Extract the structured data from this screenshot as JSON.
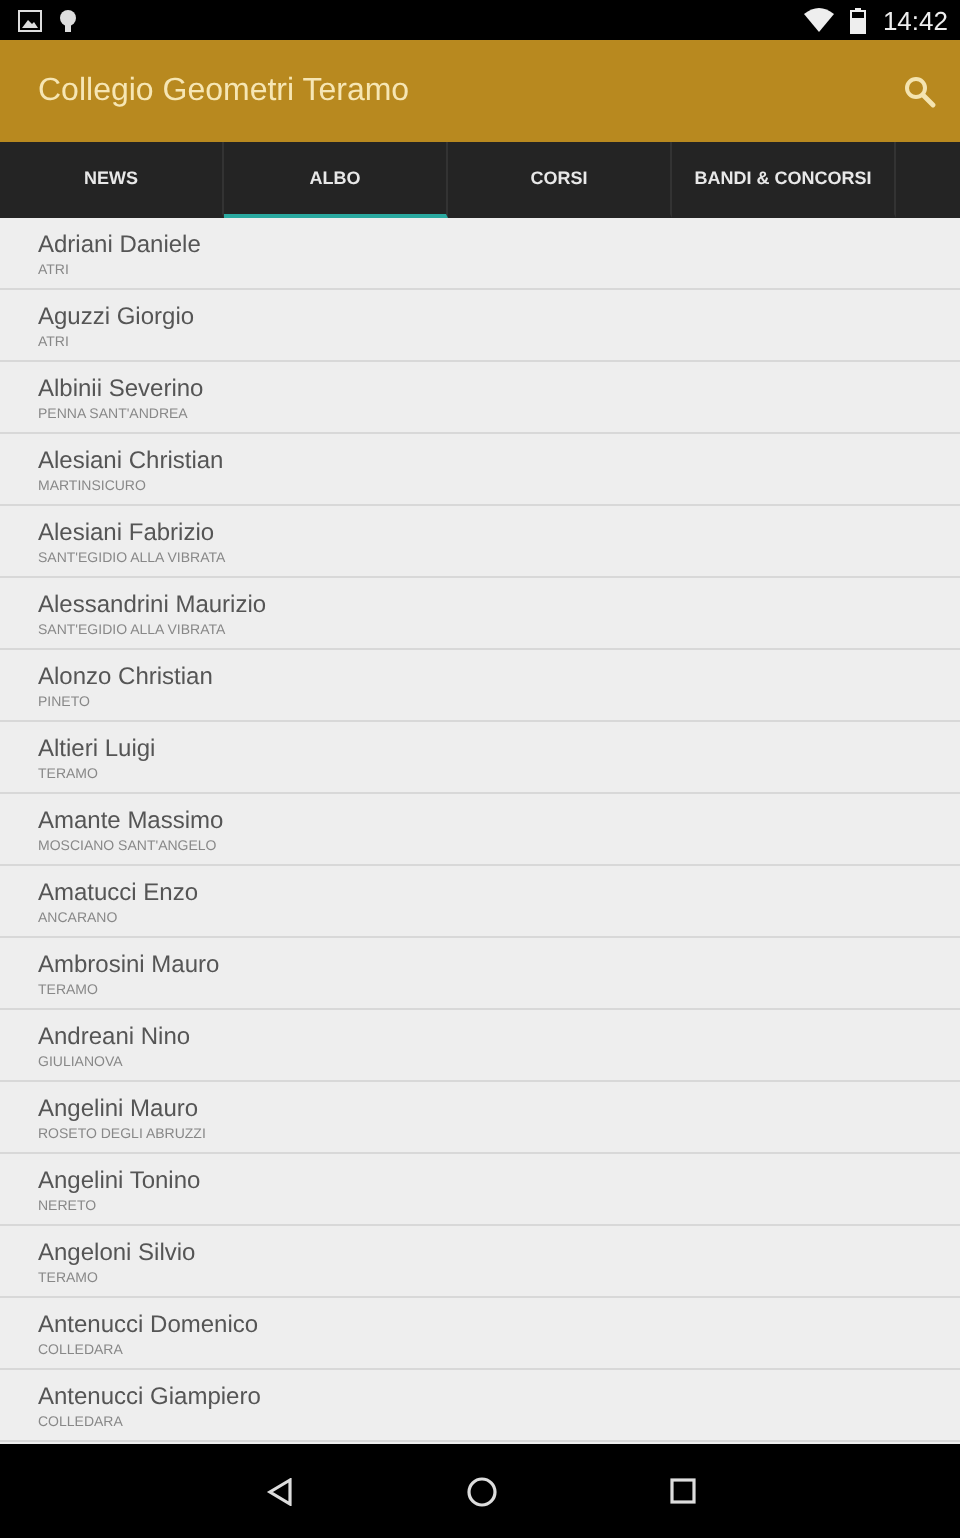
{
  "status_bar": {
    "time": "14:42"
  },
  "app_bar": {
    "title": "Collegio Geometri Teramo"
  },
  "tabs": [
    {
      "label": "NEWS",
      "selected": false
    },
    {
      "label": "ALBO",
      "selected": true
    },
    {
      "label": "CORSI",
      "selected": false
    },
    {
      "label": "BANDI & CONCORSI",
      "selected": false
    }
  ],
  "members": [
    {
      "name": "Adriani Daniele",
      "town": "ATRI"
    },
    {
      "name": "Aguzzi Giorgio",
      "town": "ATRI"
    },
    {
      "name": "Albinii Severino",
      "town": "PENNA SANT'ANDREA"
    },
    {
      "name": "Alesiani Christian",
      "town": "MARTINSICURO"
    },
    {
      "name": "Alesiani Fabrizio",
      "town": "SANT'EGIDIO ALLA VIBRATA"
    },
    {
      "name": "Alessandrini Maurizio",
      "town": "SANT'EGIDIO ALLA VIBRATA"
    },
    {
      "name": "Alonzo Christian",
      "town": "PINETO"
    },
    {
      "name": "Altieri Luigi",
      "town": "TERAMO"
    },
    {
      "name": "Amante Massimo",
      "town": "MOSCIANO SANT'ANGELO"
    },
    {
      "name": "Amatucci Enzo",
      "town": "ANCARANO"
    },
    {
      "name": "Ambrosini Mauro",
      "town": "TERAMO"
    },
    {
      "name": "Andreani Nino",
      "town": "GIULIANOVA"
    },
    {
      "name": "Angelini Mauro",
      "town": "ROSETO DEGLI ABRUZZI"
    },
    {
      "name": "Angelini Tonino",
      "town": "NERETO"
    },
    {
      "name": "Angeloni Silvio",
      "town": "TERAMO"
    },
    {
      "name": "Antenucci Domenico",
      "town": "COLLEDARA"
    },
    {
      "name": "Antenucci Giampiero",
      "town": "COLLEDARA"
    }
  ]
}
